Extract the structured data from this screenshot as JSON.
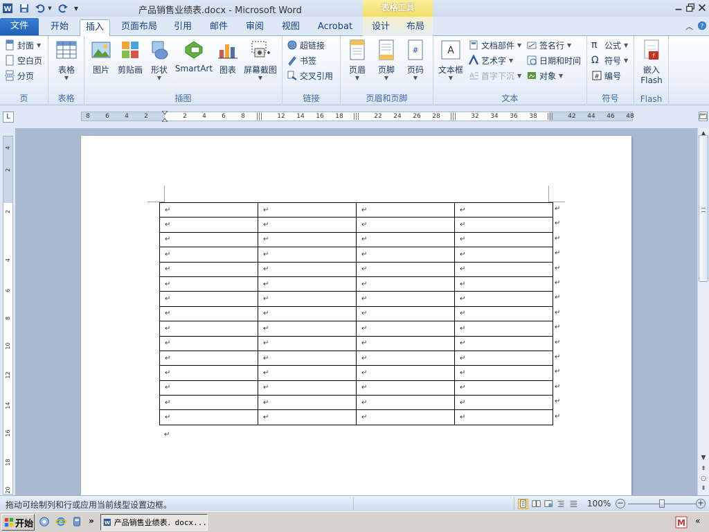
{
  "window": {
    "title": "产品销售业绩表.docx - Microsoft Word",
    "contextual_tab_group": "表格工具"
  },
  "tabs": {
    "file": "文件",
    "items": [
      {
        "id": "home",
        "label": "开始"
      },
      {
        "id": "insert",
        "label": "插入",
        "active": true
      },
      {
        "id": "page-layout",
        "label": "页面布局"
      },
      {
        "id": "references",
        "label": "引用"
      },
      {
        "id": "mailings",
        "label": "邮件"
      },
      {
        "id": "review",
        "label": "审阅"
      },
      {
        "id": "view",
        "label": "视图"
      },
      {
        "id": "acrobat",
        "label": "Acrobat"
      },
      {
        "id": "design",
        "label": "设计"
      },
      {
        "id": "layout",
        "label": "布局"
      }
    ]
  },
  "ribbon": {
    "pages": {
      "label": "页",
      "cover": "封面",
      "blank": "空白页",
      "break": "分页"
    },
    "tables": {
      "label": "表格",
      "table": "表格"
    },
    "illustrations": {
      "label": "插图",
      "picture": "图片",
      "clipart": "剪贴画",
      "shapes": "形状",
      "smartart": "SmartArt",
      "chart": "图表",
      "screenshot": "屏幕截图"
    },
    "links": {
      "label": "链接",
      "hyperlink": "超链接",
      "bookmark": "书签",
      "crossref": "交叉引用"
    },
    "header_footer": {
      "label": "页眉和页脚",
      "header": "页眉",
      "footer": "页脚",
      "page_number": "页码"
    },
    "text": {
      "label": "文本",
      "textbox": "文本框",
      "quickparts": "文档部件",
      "wordart": "艺术字",
      "dropcap": "首字下沉",
      "signature": "签名行",
      "datetime": "日期和时间",
      "object": "对象"
    },
    "symbols": {
      "label": "符号",
      "equation": "公式",
      "symbol": "符号",
      "numbering": "编号"
    },
    "flash": {
      "label": "Flash",
      "embed_line1": "嵌入",
      "embed_line2": "Flash"
    }
  },
  "ruler": {
    "corner": "L",
    "left_numbers": [
      "8",
      "6",
      "4",
      "2"
    ],
    "right_numbers": [
      "2",
      "4",
      "6",
      "8",
      "12",
      "14",
      "16",
      "18",
      "22",
      "24",
      "26",
      "28",
      "32",
      "34",
      "36",
      "38",
      "42",
      "44",
      "46",
      "48"
    ],
    "vertical_numbers": [
      "4",
      "2",
      "2",
      "4",
      "6",
      "8",
      "10",
      "12",
      "14",
      "16",
      "18",
      "20"
    ]
  },
  "document": {
    "paragraph_mark": "↵",
    "rows": 15,
    "columns": 4
  },
  "statusbar": {
    "message": "拖动可绘制列和行或应用当前线型设置边框。",
    "zoom": "100%",
    "zoom_out": "−",
    "zoom_in": "+",
    "zoom_fraction": 0.5
  },
  "taskbar": {
    "start": "开始",
    "task_word": "产品销售业绩表．docx...",
    "overflow": "»"
  }
}
